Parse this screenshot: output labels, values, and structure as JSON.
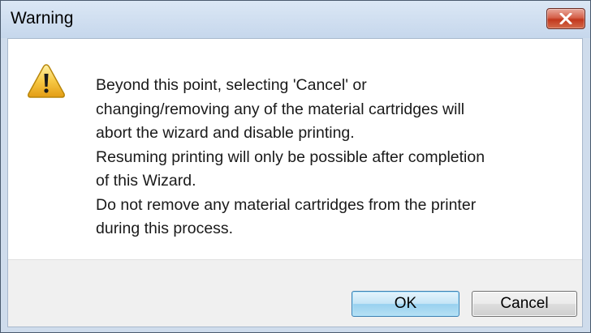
{
  "window": {
    "title": "Warning",
    "close_icon": "close-x-icon"
  },
  "message": {
    "icon": "warning-triangle-icon",
    "lines": [
      "Beyond this point, selecting 'Cancel' or",
      "changing/removing any of the material cartridges will",
      "abort the wizard and disable printing.",
      "Resuming printing will only be possible after completion",
      "of this Wizard.",
      "Do not remove any material cartridges from the printer",
      "during this process."
    ]
  },
  "buttons": {
    "ok_label": "OK",
    "cancel_label": "Cancel"
  },
  "colors": {
    "title_bar": "#c6d7ec",
    "close_button": "#c2381e",
    "footer": "#f0f0f0",
    "ok_focus_border": "#3c7fb1"
  }
}
